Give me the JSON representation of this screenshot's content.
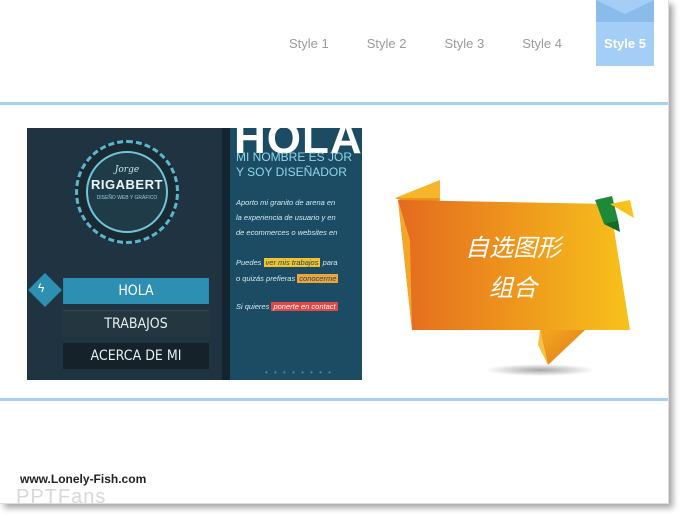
{
  "nav": {
    "items": [
      "Style 1",
      "Style 2",
      "Style 3",
      "Style 4"
    ],
    "active": "Style 5",
    "active_color": "#a4cef5"
  },
  "screenshot": {
    "logo_small": "Jorge",
    "logo_big": "RIGABERT",
    "logo_tiny": "DISEÑO WEB Y GRÁFICO",
    "menu": [
      "HOLA",
      "TRABAJOS",
      "ACERCA DE MI"
    ],
    "hola": "HOLA!",
    "sub1": "MI NOMBRE ES JOR",
    "sub2": "Y SOY DISEÑADOR",
    "para1": "Aporto mi granito de arena en",
    "para2": "la experiencia de usuario y en",
    "para3": "de ecommerces o websites en",
    "line4_a": "Puedes",
    "line4_link": "ver mis trabajos",
    "line4_b": "para",
    "line5_a": "o quizás prefieras",
    "line5_link": "conocerme",
    "line6_a": "Si quieres",
    "line6_link": "ponerte en contact",
    "pager": "• • • • • • • •"
  },
  "banner": {
    "line1": "自选图形",
    "line2": "组合",
    "gradient_start": "#e46a1e",
    "gradient_end": "#f7c21b"
  },
  "watermark": {
    "url": "www.Lonely-Fish.com",
    "brand": "PPTFans"
  }
}
